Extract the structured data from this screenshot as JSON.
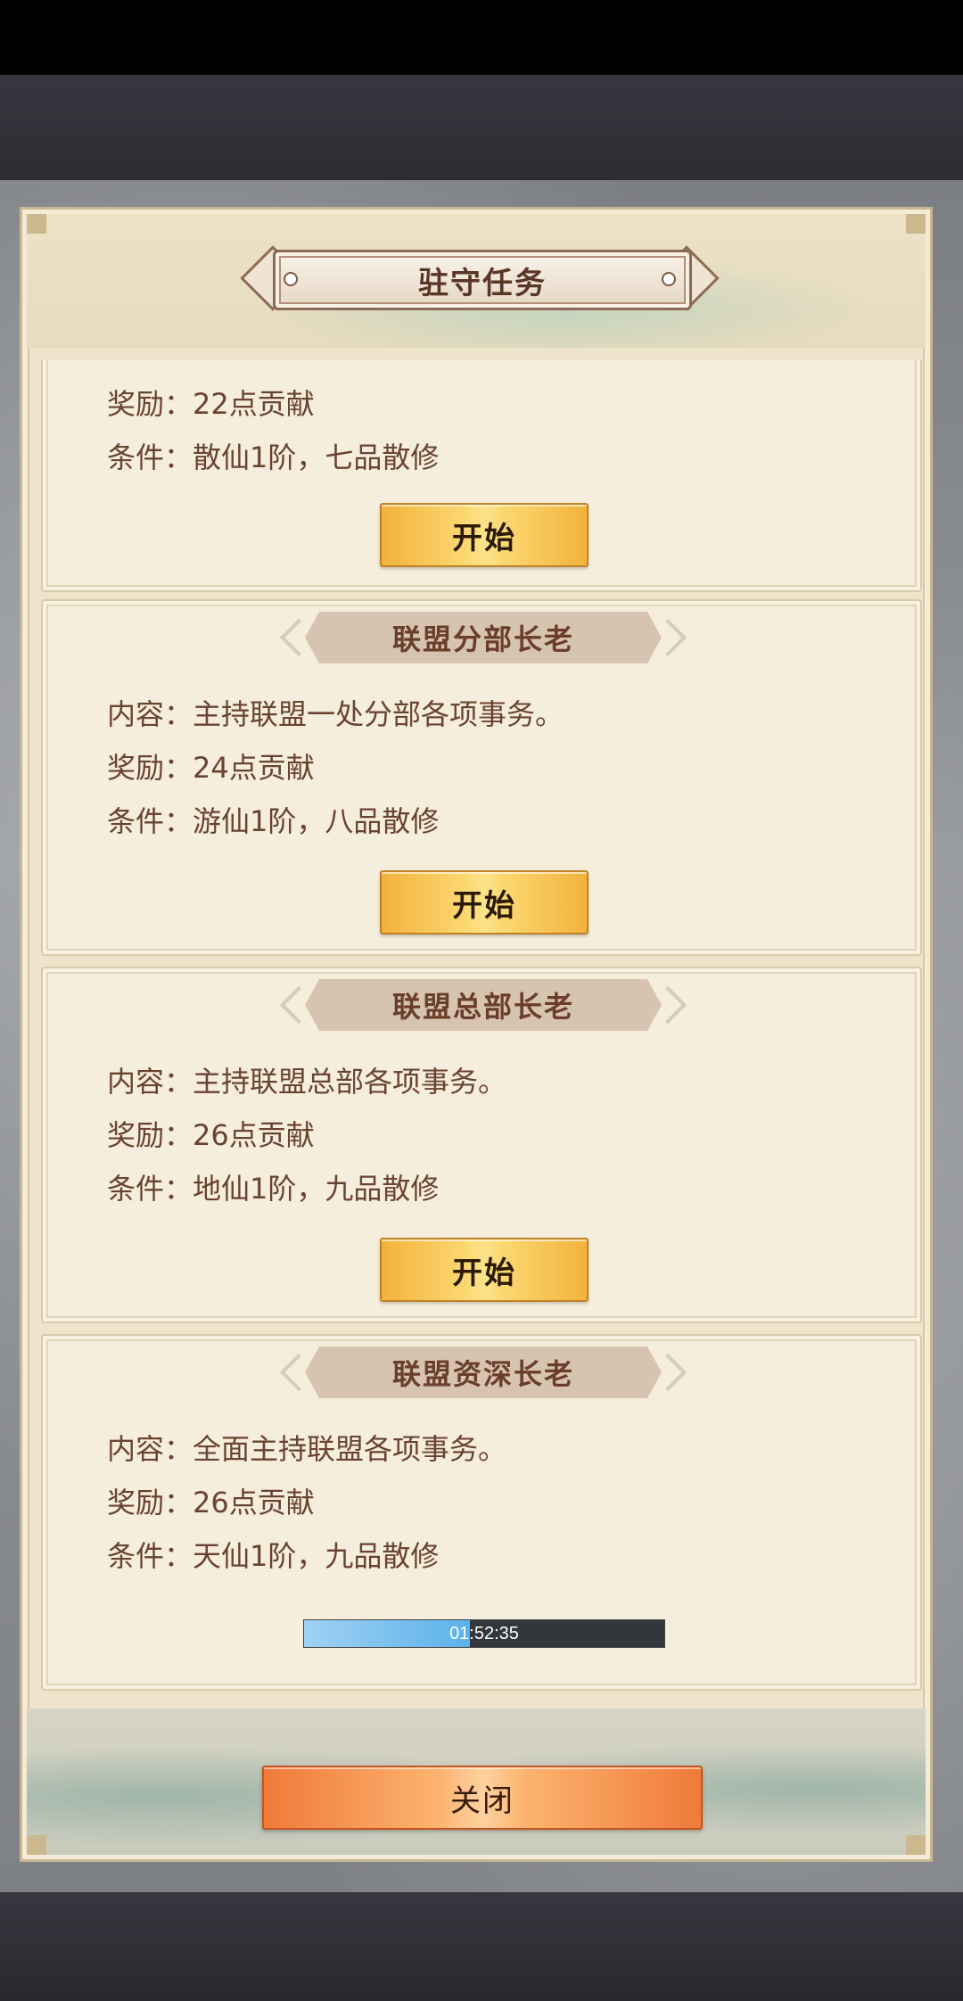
{
  "dialog": {
    "title": "驻守任务",
    "close_label": "关闭"
  },
  "tasks": [
    {
      "title": "",
      "content": "",
      "reward": "奖励：22点贡献",
      "condition": "条件：散仙1阶，七品散修",
      "action": {
        "type": "button",
        "label": "开始"
      }
    },
    {
      "title": "联盟分部长老",
      "content": "内容：主持联盟一处分部各项事务。",
      "reward": "奖励：24点贡献",
      "condition": "条件：游仙1阶，八品散修",
      "action": {
        "type": "button",
        "label": "开始"
      }
    },
    {
      "title": "联盟总部长老",
      "content": "内容：主持联盟总部各项事务。",
      "reward": "奖励：26点贡献",
      "condition": "条件：地仙1阶，九品散修",
      "action": {
        "type": "button",
        "label": "开始"
      }
    },
    {
      "title": "联盟资深长老",
      "content": "内容：全面主持联盟各项事务。",
      "reward": "奖励：26点贡献",
      "condition": "条件：天仙1阶，九品散修",
      "action": {
        "type": "timer",
        "label": "01:52:35",
        "progress": 0.46
      }
    }
  ],
  "colors": {
    "start_button": "#fbd770",
    "close_button": "#fbb36f",
    "timer_fill": "#5cb1ea"
  }
}
